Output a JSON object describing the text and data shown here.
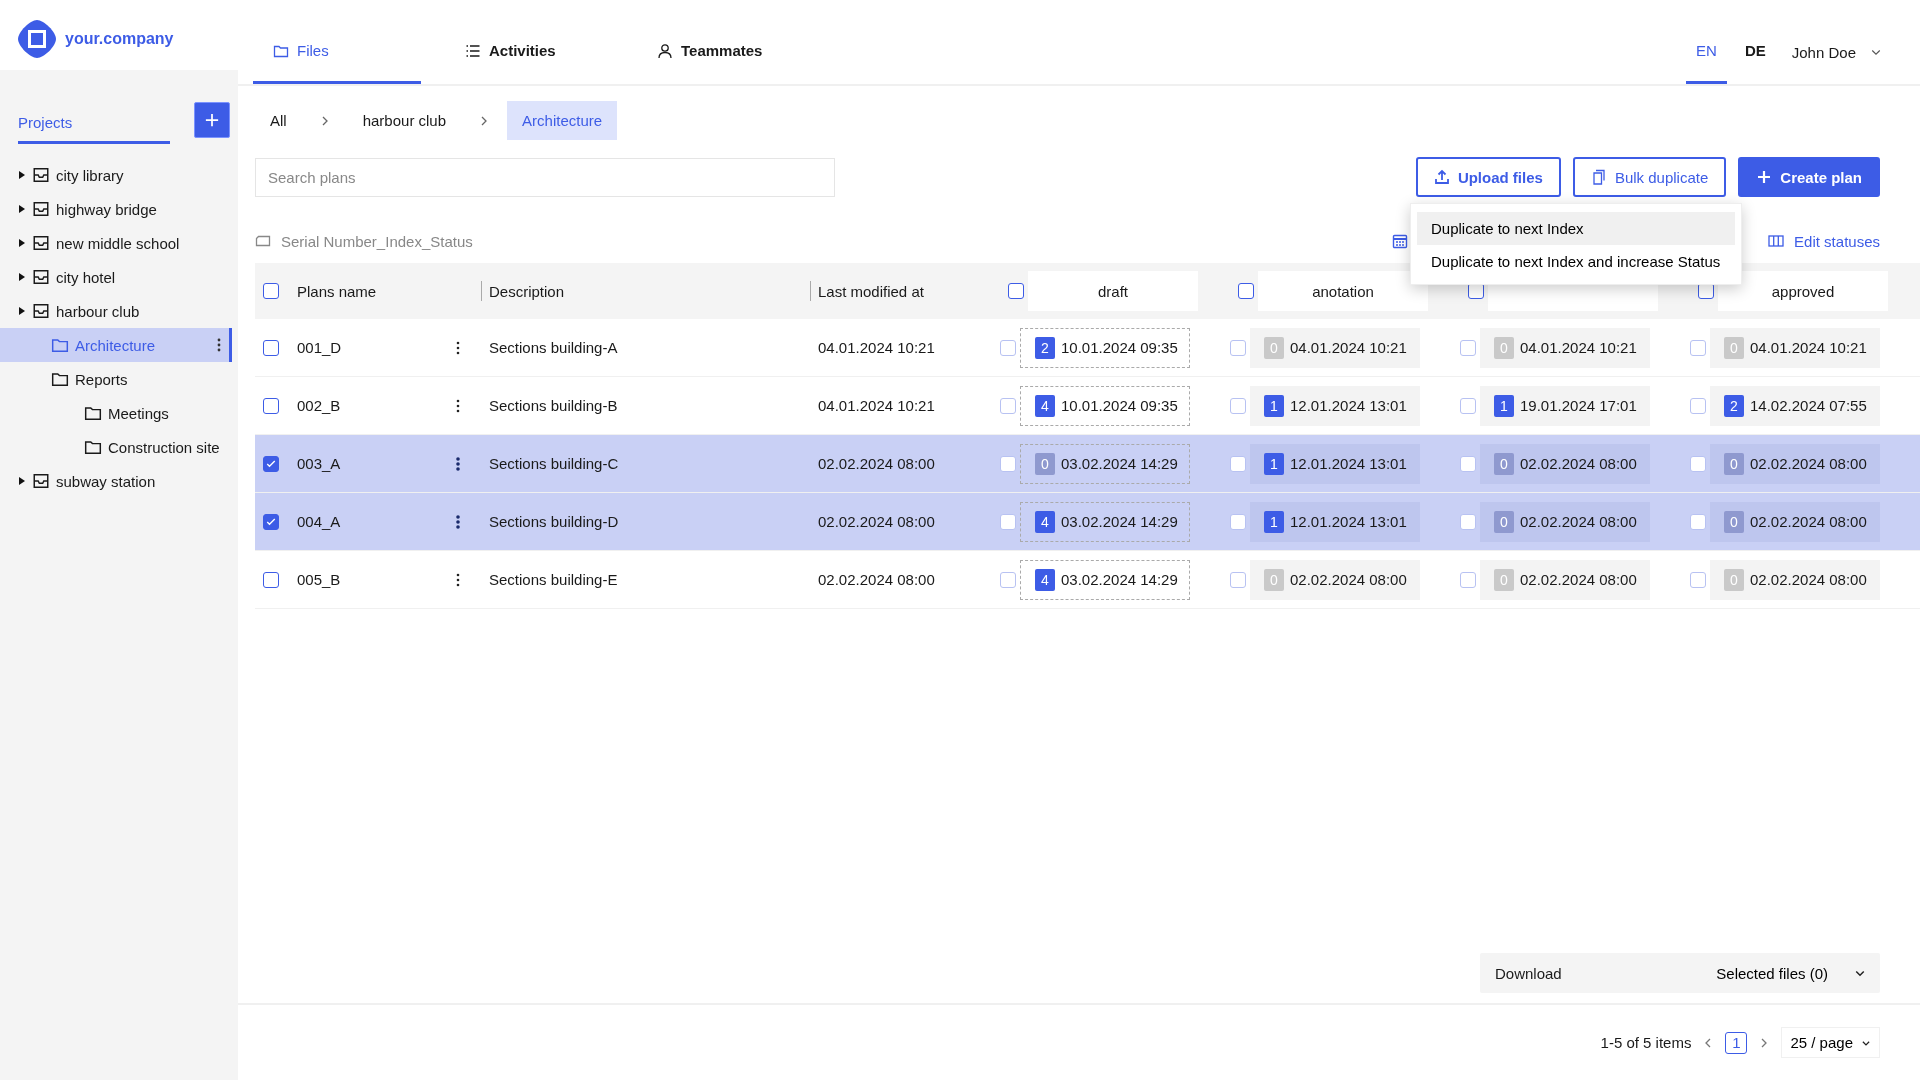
{
  "brand": {
    "name": "your.company"
  },
  "nav_tabs": [
    {
      "label": "Files",
      "kind": "folder",
      "selected": true
    },
    {
      "label": "Activities",
      "kind": "list",
      "selected": false
    },
    {
      "label": "Teammates",
      "kind": "person",
      "selected": false
    }
  ],
  "languages": [
    {
      "label": "EN",
      "selected": true
    },
    {
      "label": "DE",
      "selected": false
    }
  ],
  "user": {
    "name": "John Doe"
  },
  "sidebar": {
    "title": "Projects",
    "items": [
      {
        "label": "city library",
        "selected": false
      },
      {
        "label": "highway bridge",
        "selected": false
      },
      {
        "label": "new middle school",
        "selected": false
      },
      {
        "label": "city hotel",
        "selected": false
      },
      {
        "label": "harbour club",
        "selected": false,
        "children": [
          {
            "label": "Architecture",
            "selected": true
          },
          {
            "label": "Reports",
            "selected": false,
            "children": [
              {
                "label": "Meetings",
                "selected": false
              },
              {
                "label": "Construction site",
                "selected": false
              }
            ]
          }
        ]
      },
      {
        "label": "subway station",
        "selected": false
      }
    ]
  },
  "breadcrumbs": [
    {
      "label": "All",
      "selected": false
    },
    {
      "label": "harbour club",
      "selected": false
    },
    {
      "label": "Architecture",
      "selected": true
    }
  ],
  "search": {
    "placeholder": "Search plans"
  },
  "buttons": [
    {
      "label": "Upload files",
      "kind": "upload"
    },
    {
      "label": "Bulk duplicate",
      "kind": "duplicate"
    },
    {
      "label": "Create plan",
      "kind": "create"
    }
  ],
  "dropdown_menu": [
    {
      "label": "Duplicate to next Index",
      "selected": true
    },
    {
      "label": "Duplicate to next Index and increase Status",
      "selected": false
    }
  ],
  "naming_pattern": "Serial Number_Index_Status",
  "edit_statuses": "Edit statuses",
  "table": {
    "all_checked": false,
    "columns": [
      "Plans name",
      "Description",
      "Last modified at"
    ],
    "status_columns": [
      {
        "label": "draft",
        "kind": "draft",
        "checked": false
      },
      {
        "label": "anotation",
        "kind": "status",
        "checked": false
      },
      {
        "kind": "status",
        "checked": false
      },
      {
        "label": "approved",
        "kind": "status",
        "checked": false
      }
    ],
    "rows": [
      {
        "name": "001_D",
        "description": "Sections building-A",
        "modified": "04.01.2024 10:21",
        "selected": false,
        "statuses": [
          {
            "count": "2",
            "date": "10.01.2024 09:35",
            "checked": false
          },
          {
            "count": "0",
            "date": "04.01.2024 10:21",
            "checked": false
          },
          {
            "count": "0",
            "date": "04.01.2024 10:21",
            "checked": false
          },
          {
            "count": "0",
            "date": "04.01.2024 10:21",
            "checked": false
          }
        ]
      },
      {
        "name": "002_B",
        "description": "Sections building-B",
        "modified": "04.01.2024 10:21",
        "selected": false,
        "statuses": [
          {
            "count": "4",
            "date": "10.01.2024 09:35",
            "checked": false
          },
          {
            "count": "1",
            "date": "12.01.2024 13:01",
            "checked": false
          },
          {
            "count": "1",
            "date": "19.01.2024 17:01",
            "checked": false
          },
          {
            "count": "2",
            "date": "14.02.2024 07:55",
            "checked": false
          }
        ]
      },
      {
        "name": "003_A",
        "description": "Sections building-C",
        "modified": "02.02.2024 08:00",
        "selected": true,
        "statuses": [
          {
            "count": "0",
            "date": "03.02.2024 14:29",
            "checked": false
          },
          {
            "count": "1",
            "date": "12.01.2024 13:01",
            "checked": false
          },
          {
            "count": "0",
            "date": "02.02.2024 08:00",
            "checked": false
          },
          {
            "count": "0",
            "date": "02.02.2024 08:00",
            "checked": false
          }
        ]
      },
      {
        "name": "004_A",
        "description": "Sections building-D",
        "modified": "02.02.2024 08:00",
        "selected": true,
        "statuses": [
          {
            "count": "4",
            "date": "03.02.2024 14:29",
            "checked": false
          },
          {
            "count": "1",
            "date": "12.01.2024 13:01",
            "checked": false
          },
          {
            "count": "0",
            "date": "02.02.2024 08:00",
            "checked": false
          },
          {
            "count": "0",
            "date": "02.02.2024 08:00",
            "checked": false
          }
        ]
      },
      {
        "name": "005_B",
        "description": "Sections building-E",
        "modified": "02.02.2024 08:00",
        "selected": false,
        "statuses": [
          {
            "count": "4",
            "date": "03.02.2024 14:29",
            "checked": false
          },
          {
            "count": "0",
            "date": "02.02.2024 08:00",
            "checked": false
          },
          {
            "count": "0",
            "date": "02.02.2024 08:00",
            "checked": false
          },
          {
            "count": "0",
            "date": "02.02.2024 08:00",
            "checked": false
          }
        ]
      }
    ]
  },
  "download": {
    "label": "Download",
    "selection": "Selected files (0)"
  },
  "pagination": {
    "summary": "1-5 of 5 items",
    "page": "1",
    "page_size": "25 / page"
  }
}
